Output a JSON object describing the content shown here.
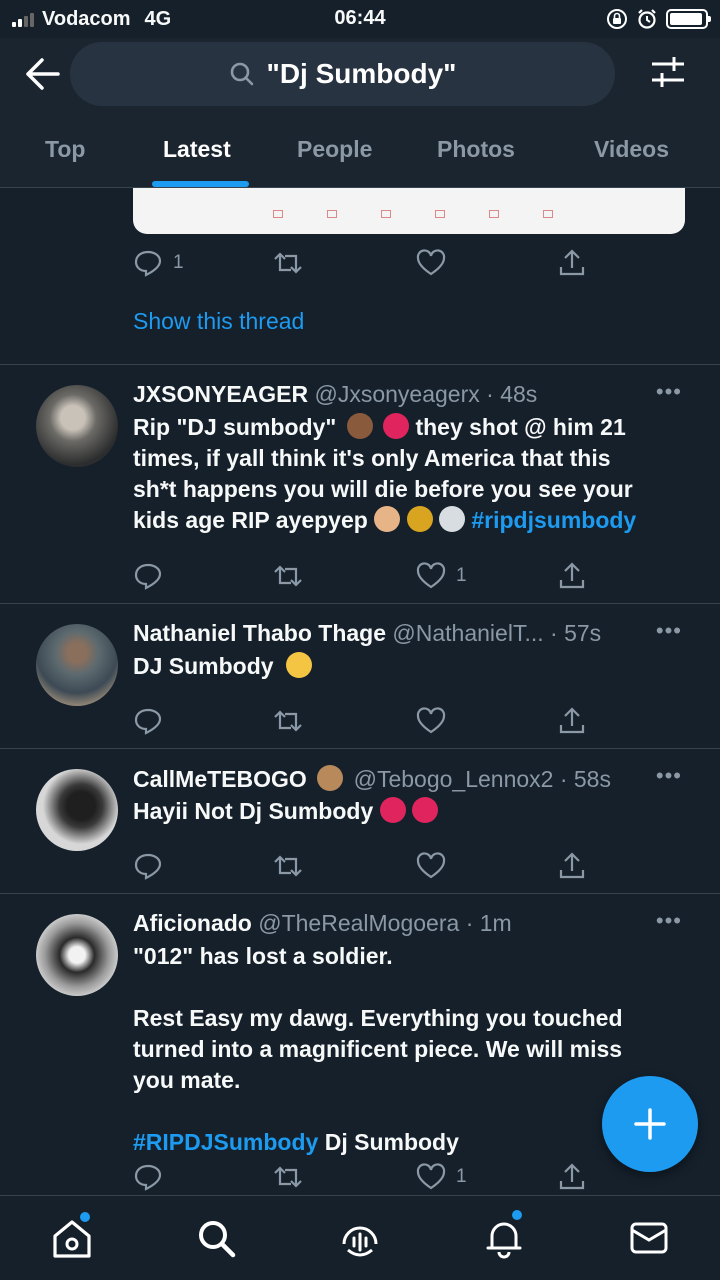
{
  "status_bar": {
    "carrier": "Vodacom",
    "network": "4G",
    "time": "06:44",
    "battery_level": 0.95
  },
  "search": {
    "query": "\"Dj Sumbody\""
  },
  "tabs": [
    {
      "label": "Top",
      "active": false
    },
    {
      "label": "Latest",
      "active": true
    },
    {
      "label": "People",
      "active": false
    },
    {
      "label": "Photos",
      "active": false
    },
    {
      "label": "Videos",
      "active": false
    }
  ],
  "prev_tweet": {
    "reply_count": "1",
    "show_thread": "Show this thread"
  },
  "tweets": [
    {
      "name": "JXSONYEAGER",
      "handle": "@Jxsonyeagerx",
      "time": "· 48s",
      "line1_a": "Rip \"DJ sumbody\"",
      "line1_b": "they shot @ him 21",
      "line2": "times, if yall think it's only America that this",
      "line3": "sh*t happens you will die before you see your",
      "line4": "kids age RIP ayepyep",
      "hashtag": "#ripdjsumbody",
      "like_count": "1"
    },
    {
      "name": "Nathaniel Thabo Thage",
      "handle": "@NathanielT...",
      "time": "· 57s",
      "text": "DJ Sumbody"
    },
    {
      "name": "CallMeTEBOGO",
      "handle": "@Tebogo_Lennox2",
      "time": "· 58s",
      "text": "Hayii Not Dj Sumbody"
    },
    {
      "name": "Aficionado",
      "handle": "@TheRealMogoera",
      "time": "· 1m",
      "line1": "\"012\" has lost a soldier.",
      "line2": "Rest Easy my dawg. Everything you touched",
      "line3": "turned into a magnificent piece. We will miss",
      "line4": "you mate.",
      "hashtag": "#RIPDJSumbody",
      "tail": " Dj Sumbody",
      "like_count": "1"
    }
  ],
  "icons": {
    "back": "arrow-left-icon",
    "search": "search-icon",
    "filter": "sliders-icon",
    "reply": "reply-icon",
    "retweet": "retweet-icon",
    "like": "heart-icon",
    "share": "share-icon",
    "compose": "plus-icon"
  },
  "colors": {
    "background": "#15202b",
    "accent": "#1d9bf0",
    "muted": "#8b98a5",
    "divider": "#38444d"
  }
}
